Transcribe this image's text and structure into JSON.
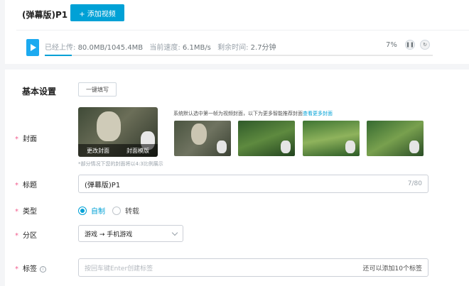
{
  "header": {
    "file_title": "(弹幕版)P1",
    "add_video_label": "+ 添加视频"
  },
  "upload": {
    "uploaded_label": "已经上传:",
    "uploaded_value": "80.0MB/1045.4MB",
    "speed_label": "当前速度:",
    "speed_value": "6.1MB/s",
    "remaining_label": "剩余时间:",
    "remaining_value": "2.7分钟",
    "percent_text": "7%",
    "progress_fraction": 0.07,
    "pause_icon": "pause-icon",
    "retry_icon": "retry-icon"
  },
  "form": {
    "section_title": "基本设置",
    "quick_fill_label": "一键填写",
    "cover": {
      "label": "封面",
      "change_cover_label": "更改封面",
      "cover_template_label": "封面模版",
      "hint_text": "系统默认选中第一帧为视频封面，以下为更多智能推荐封面",
      "hint_link": "查看更多封面",
      "note": "*部分情况下您的封面将以4:3比例展示"
    },
    "title": {
      "label": "标题",
      "value": "(弹幕版)P1",
      "count": "7/80"
    },
    "type": {
      "label": "类型",
      "options": [
        "自制",
        "转载"
      ],
      "selected": "自制"
    },
    "category": {
      "label": "分区",
      "value": "游戏 → 手机游戏"
    },
    "tags": {
      "label": "标签",
      "placeholder": "按回车键Enter创建标签",
      "remaining": "还可以添加10个标签"
    },
    "required_mark": "*"
  },
  "colors": {
    "accent": "#00a1d6",
    "required": "#f25d8e"
  }
}
